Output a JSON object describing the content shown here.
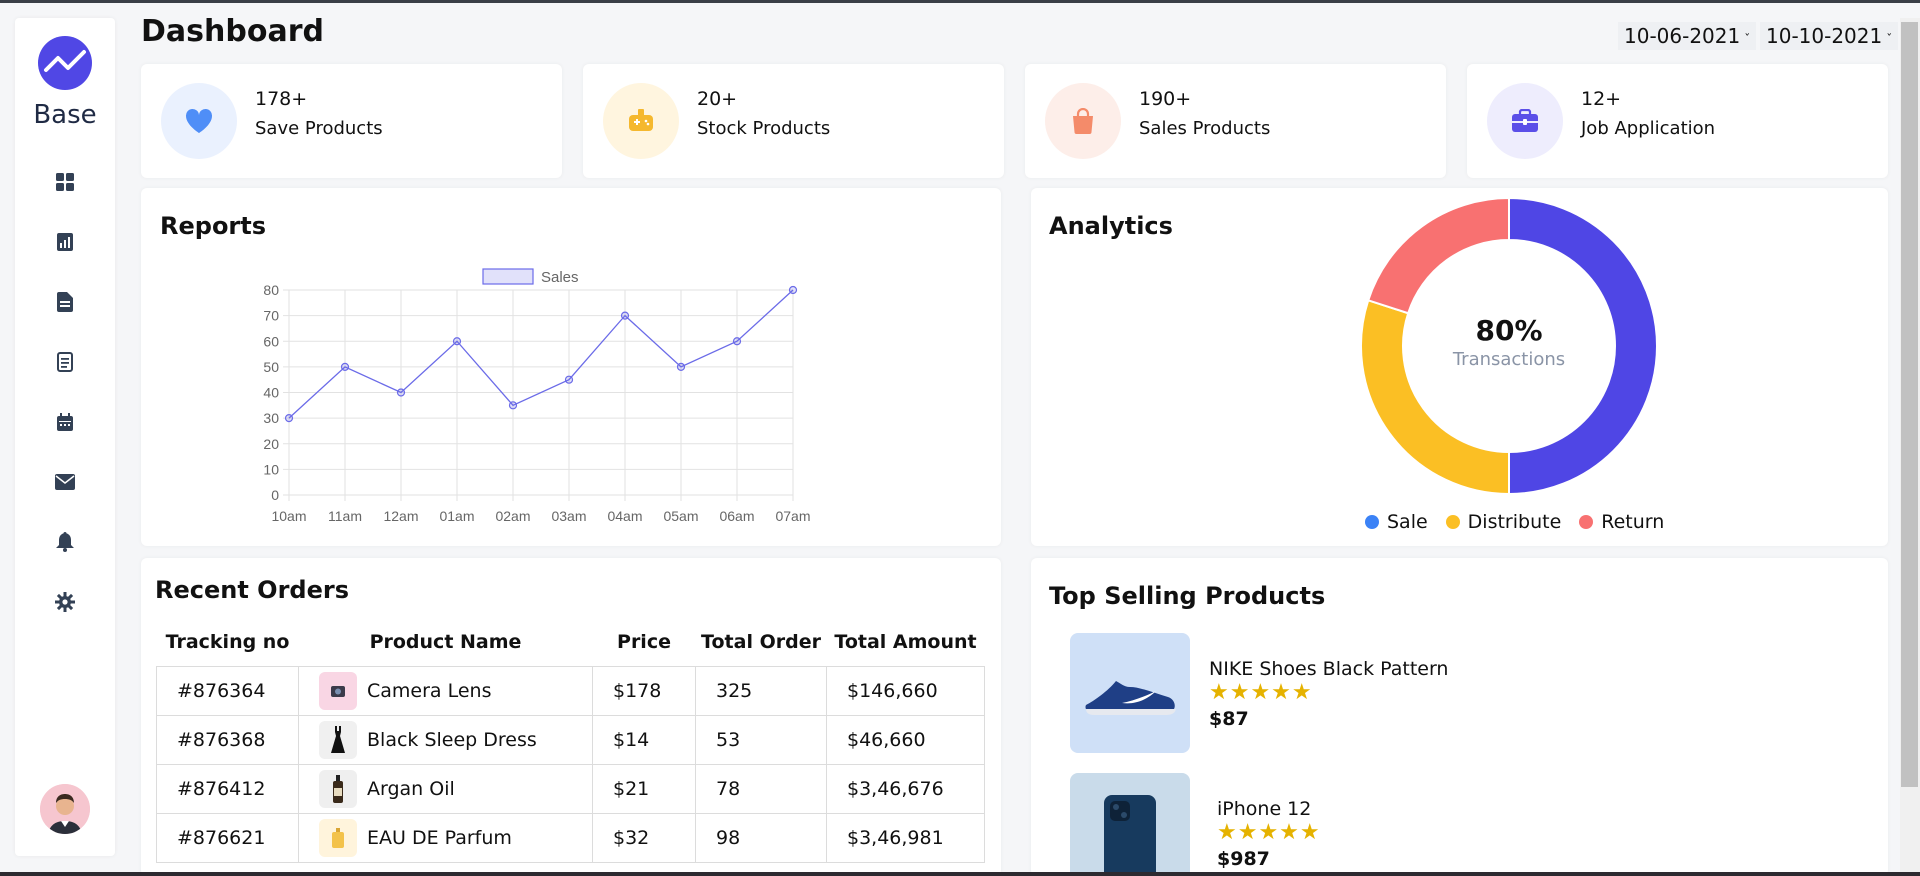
{
  "sidebar": {
    "logo_text": "Base",
    "nav": [
      "dashboard-icon",
      "chart-icon",
      "document-icon",
      "list-icon",
      "calendar-icon",
      "mail-icon",
      "bell-icon",
      "gear-icon"
    ]
  },
  "header": {
    "title": "Dashboard",
    "date_from": "10-06-2021",
    "date_to": "10-10-2021"
  },
  "stats": [
    {
      "value": "178+",
      "label": "Save Products",
      "icon": "heart-icon",
      "color": "#4f8ef7",
      "bg": "#eaf1fe"
    },
    {
      "value": "20+",
      "label": "Stock Products",
      "icon": "gamepad-icon",
      "color": "#f5b82e",
      "bg": "#fff5df"
    },
    {
      "value": "190+",
      "label": "Sales Products",
      "icon": "bag-icon",
      "color": "#f48b6a",
      "bg": "#fdeee9"
    },
    {
      "value": "12+",
      "label": "Job Application",
      "icon": "briefcase-icon",
      "color": "#5b4fe8",
      "bg": "#eeedfd"
    }
  ],
  "reports": {
    "title": "Reports"
  },
  "chart_data": {
    "type": "line",
    "categories": [
      "10am",
      "11am",
      "12am",
      "01am",
      "02am",
      "03am",
      "04am",
      "05am",
      "06am",
      "07am"
    ],
    "series": [
      {
        "name": "Sales",
        "values": [
          30,
          50,
          40,
          60,
          35,
          45,
          70,
          50,
          60,
          80
        ]
      }
    ],
    "ylim": [
      0,
      80
    ],
    "yticks": [
      0,
      10,
      20,
      30,
      40,
      50,
      60,
      70,
      80
    ],
    "grid": true,
    "legend": "top",
    "color": "#6b6be8"
  },
  "analytics": {
    "title": "Analytics",
    "center_value": "80%",
    "center_label": "Transactions",
    "segments": [
      {
        "name": "Sale",
        "value": 50,
        "color": "#4f46e5"
      },
      {
        "name": "Distribute",
        "value": 30,
        "color": "#fbbf24"
      },
      {
        "name": "Return",
        "value": 20,
        "color": "#f87171"
      }
    ],
    "legend": [
      {
        "label": "Sale",
        "color": "#3b82f6"
      },
      {
        "label": "Distribute",
        "color": "#fbbf24"
      },
      {
        "label": "Return",
        "color": "#f87171"
      }
    ]
  },
  "orders": {
    "title": "Recent Orders",
    "headers": [
      "Tracking no",
      "Product Name",
      "Price",
      "Total Order",
      "Total Amount"
    ],
    "rows": [
      {
        "tracking": "#876364",
        "product": "Camera Lens",
        "price": "$178",
        "total_order": "325",
        "amount": "$146,660",
        "thumb_bg": "#f9d6e4"
      },
      {
        "tracking": "#876368",
        "product": "Black Sleep Dress",
        "price": "$14",
        "total_order": "53",
        "amount": "$46,660",
        "thumb_bg": "#f0f0f0"
      },
      {
        "tracking": "#876412",
        "product": "Argan Oil",
        "price": "$21",
        "total_order": "78",
        "amount": "$3,46,676",
        "thumb_bg": "#efefef"
      },
      {
        "tracking": "#876621",
        "product": "EAU DE Parfum",
        "price": "$32",
        "total_order": "98",
        "amount": "$3,46,981",
        "thumb_bg": "#fff4dc"
      }
    ]
  },
  "top_selling": {
    "title": "Top Selling Products",
    "items": [
      {
        "name": "NIKE Shoes Black Pattern",
        "rating": 5,
        "stars": "★★★★★",
        "price": "$87"
      },
      {
        "name": "iPhone 12",
        "rating": 5,
        "stars": "★★★★★",
        "price": "$987"
      }
    ]
  }
}
